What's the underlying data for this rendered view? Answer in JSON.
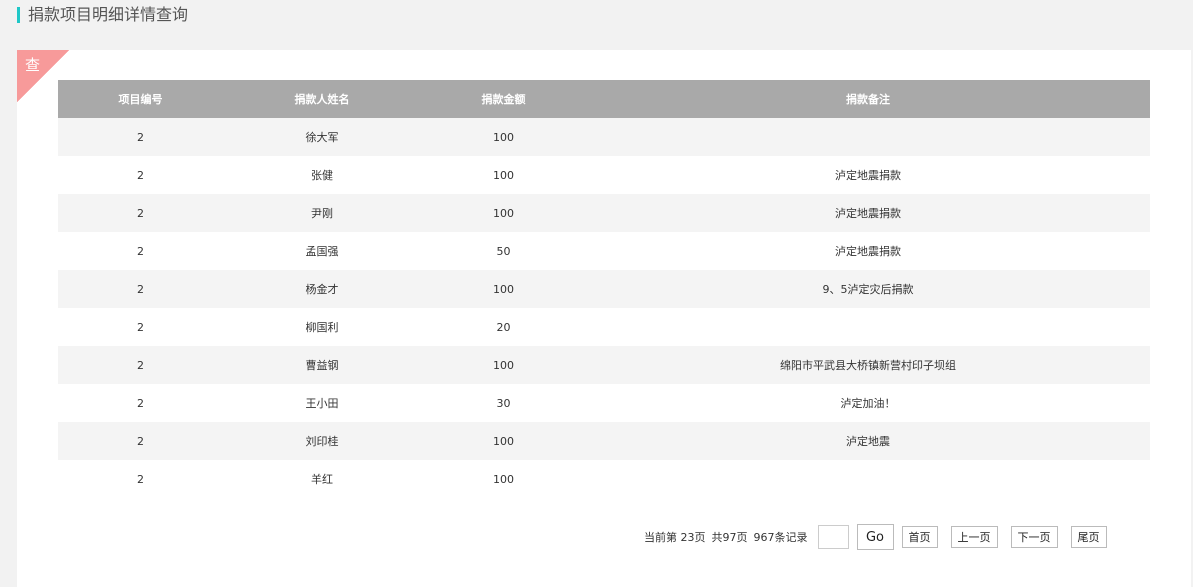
{
  "header": {
    "title": "捐款项目明细详情查询"
  },
  "corner_label": "查",
  "table": {
    "columns": [
      "项目编号",
      "捐款人姓名",
      "捐款金额",
      "捐款备注"
    ],
    "rows": [
      [
        "2",
        "徐大军",
        "100",
        ""
      ],
      [
        "2",
        "张健",
        "100",
        "泸定地震捐款"
      ],
      [
        "2",
        "尹刚",
        "100",
        "泸定地震捐款"
      ],
      [
        "2",
        "孟国强",
        "50",
        "泸定地震捐款"
      ],
      [
        "2",
        "杨金才",
        "100",
        "9、5泸定灾后捐款"
      ],
      [
        "2",
        "柳国利",
        "20",
        ""
      ],
      [
        "2",
        "曹益钢",
        "100",
        "绵阳市平武县大桥镇新营村印子坝组"
      ],
      [
        "2",
        "王小田",
        "30",
        "泸定加油！"
      ],
      [
        "2",
        "刘印桂",
        "100",
        "泸定地震"
      ],
      [
        "2",
        "羊红",
        "100",
        ""
      ]
    ]
  },
  "pager": {
    "current_text": "当前第 23页",
    "total_pages_text": "共97页",
    "total_records_text": "967条记录",
    "jump_value": "",
    "go_label": "Go",
    "first_label": "首页",
    "prev_label": "上一页",
    "next_label": "下一页",
    "last_label": "尾页"
  }
}
